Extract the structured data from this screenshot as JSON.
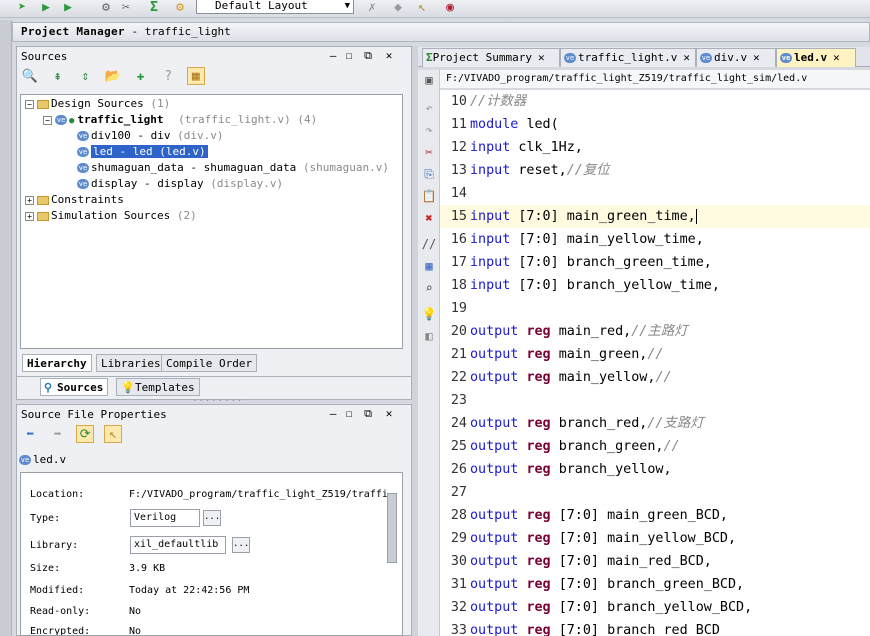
{
  "toolbar": {
    "layout_label": "Default Layout"
  },
  "project_manager": {
    "title": "Project Manager",
    "project": "- traffic_light"
  },
  "sources_panel": {
    "title": "Sources",
    "tree": {
      "design_sources": "Design Sources",
      "design_sources_count": "(1)",
      "top_module": "traffic_light",
      "top_file": "(traffic_light.v)",
      "top_count": "(4)",
      "children": [
        {
          "name": "div100 - div",
          "file": "(div.v)"
        },
        {
          "name": "led - led (led.v)",
          "file": ""
        },
        {
          "name": "shumaguan_data - shumaguan_data",
          "file": "(shumaguan.v)"
        },
        {
          "name": "display - display",
          "file": "(display.v)"
        }
      ],
      "constraints": "Constraints",
      "simulation_sources": "Simulation Sources",
      "simulation_sources_count": "(2)"
    },
    "tabs": [
      "Hierarchy",
      "Libraries",
      "Compile Order"
    ],
    "subtabs": [
      "Sources",
      "Templates"
    ]
  },
  "properties_panel": {
    "title": "Source File Properties",
    "file": "led.v",
    "rows": {
      "location_label": "Location:",
      "location_value": "F:/VIVADO_program/traffic_light_Z519/traffi",
      "type_label": "Type:",
      "type_value": "Verilog",
      "library_label": "Library:",
      "library_value": "xil_defaultlib",
      "size_label": "Size:",
      "size_value": "3.9 KB",
      "modified_label": "Modified:",
      "modified_value": "Today at 22:42:56 PM",
      "readonly_label": "Read-only:",
      "readonly_value": "No",
      "encrypted_label": "Encrypted:",
      "encrypted_value": "No"
    },
    "ellipsis": "..."
  },
  "editor": {
    "tabs": [
      "Project Summary",
      "traffic_light.v",
      "div.v",
      "led.v"
    ],
    "active_tab": "led.v",
    "path": "F:/VIVADO_program/traffic_light_Z519/traffic_light_sim/led.v",
    "lines": [
      {
        "n": "10",
        "t": "//计数器"
      },
      {
        "n": "11",
        "t": "module led("
      },
      {
        "n": "12",
        "t": "input clk_1Hz,"
      },
      {
        "n": "13",
        "t": "input reset,//复位"
      },
      {
        "n": "14",
        "t": ""
      },
      {
        "n": "15",
        "t": "input [7:0] main_green_time,"
      },
      {
        "n": "16",
        "t": "input [7:0] main_yellow_time,"
      },
      {
        "n": "17",
        "t": "input [7:0] branch_green_time,"
      },
      {
        "n": "18",
        "t": "input [7:0] branch_yellow_time,"
      },
      {
        "n": "19",
        "t": ""
      },
      {
        "n": "20",
        "t": "output reg main_red,//主路灯"
      },
      {
        "n": "21",
        "t": "output reg main_green,//"
      },
      {
        "n": "22",
        "t": "output reg main_yellow,//"
      },
      {
        "n": "23",
        "t": ""
      },
      {
        "n": "24",
        "t": "output reg branch_red,//支路灯"
      },
      {
        "n": "25",
        "t": "output reg branch_green,//"
      },
      {
        "n": "26",
        "t": "output reg branch_yellow,"
      },
      {
        "n": "27",
        "t": ""
      },
      {
        "n": "28",
        "t": "output reg [7:0] main_green_BCD,"
      },
      {
        "n": "29",
        "t": "output reg [7:0] main_yellow_BCD,"
      },
      {
        "n": "30",
        "t": "output reg [7:0] main_red_BCD,"
      },
      {
        "n": "31",
        "t": "output reg [7:0] branch_green_BCD,"
      },
      {
        "n": "32",
        "t": "output reg [7:0] branch_yellow_BCD,"
      },
      {
        "n": "33",
        "t": "output reg [7:0] branch_red_BCD"
      }
    ]
  },
  "colors": {
    "selection": "#2e63c9",
    "keyword": "#1a1ad4",
    "reg": "#7a0033",
    "comment": "#888888",
    "active_tab": "#fff3c4"
  }
}
